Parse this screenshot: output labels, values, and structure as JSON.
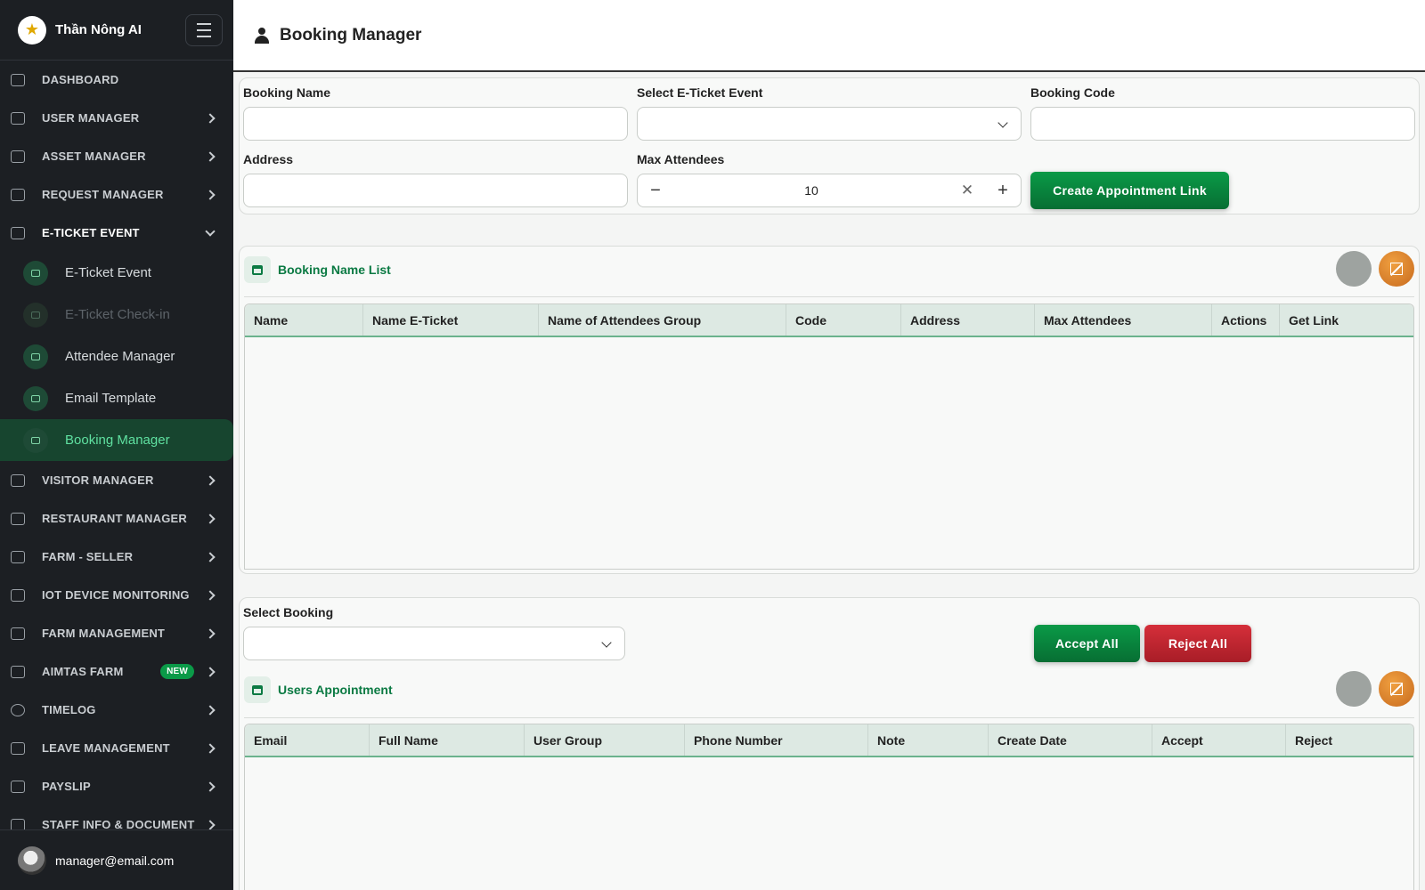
{
  "sidebar": {
    "brand": "Thần Nông AI",
    "user_email": "manager@email.com",
    "items": [
      {
        "label": "DASHBOARD",
        "icon": "dashboard-icon"
      },
      {
        "label": "USER MANAGER",
        "icon": "users-icon"
      },
      {
        "label": "ASSET MANAGER",
        "icon": "asset-icon"
      },
      {
        "label": "REQUEST MANAGER",
        "icon": "clipboard-icon"
      },
      {
        "label": "E-TICKET EVENT",
        "icon": "ticket-icon"
      },
      {
        "label": "VISITOR MANAGER",
        "icon": "visitors-icon"
      },
      {
        "label": "RESTAURANT MANAGER",
        "icon": "fork-knife-icon"
      },
      {
        "label": "FARM - SELLER",
        "icon": "store-icon"
      },
      {
        "label": "IOT DEVICE MONITORING",
        "icon": "chart-icon"
      },
      {
        "label": "FARM MANAGEMENT",
        "icon": "tractor-icon"
      },
      {
        "label": "AIMTAS FARM",
        "icon": "aimtas-icon",
        "badge": "NEW"
      },
      {
        "label": "TIMELOG",
        "icon": "clock-icon"
      },
      {
        "label": "LEAVE MANAGEMENT",
        "icon": "plane-icon"
      },
      {
        "label": "PAYSLIP",
        "icon": "payslip-icon"
      },
      {
        "label": "STAFF INFO & DOCUMENT",
        "icon": "document-icon"
      }
    ],
    "sub_items": [
      {
        "label": "E-Ticket Event"
      },
      {
        "label": "E-Ticket Check-in"
      },
      {
        "label": "Attendee Manager"
      },
      {
        "label": "Email Template"
      },
      {
        "label": "Booking Manager"
      }
    ]
  },
  "header": {
    "title": "Booking Manager"
  },
  "form": {
    "booking_name_label": "Booking Name",
    "booking_name_value": "",
    "event_label": "Select E-Ticket Event",
    "event_value": "",
    "booking_code_label": "Booking Code",
    "booking_code_value": "",
    "address_label": "Address",
    "address_value": "",
    "max_attendees_label": "Max Attendees",
    "max_attendees_value": "10",
    "create_button": "Create Appointment Link"
  },
  "booking_list": {
    "title": "Booking Name List",
    "columns": [
      "Name",
      "Name E-Ticket",
      "Name of Attendees Group",
      "Code",
      "Address",
      "Max Attendees",
      "Actions",
      "Get Link"
    ],
    "rows": []
  },
  "appointments": {
    "select_label": "Select Booking",
    "select_value": "",
    "accept_all": "Accept All",
    "reject_all": "Reject All",
    "title": "Users Appointment",
    "columns": [
      "Email",
      "Full Name",
      "User Group",
      "Phone Number",
      "Note",
      "Create Date",
      "Accept",
      "Reject"
    ],
    "rows": []
  },
  "colors": {
    "accent": "#0b7a43",
    "sidebar_bg": "#1c1f23",
    "active_bg": "#17452f",
    "reject": "#c42733"
  }
}
